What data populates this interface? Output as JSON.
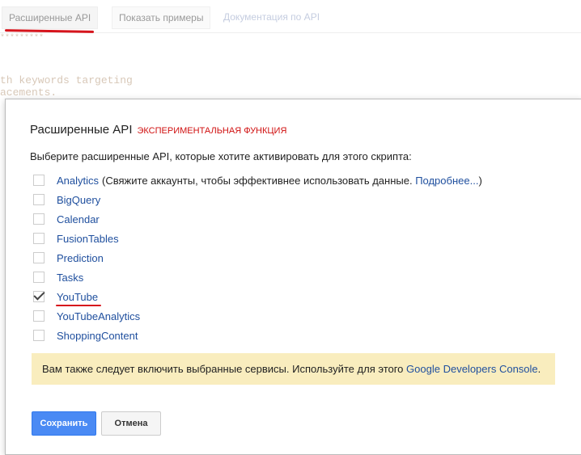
{
  "toolbar": {
    "advanced_api": "Расширенные API",
    "show_examples": "Показать примеры",
    "api_docs": "Документация по API"
  },
  "code_lines": [
    "*********",
    "th keywords targeting",
    "acements."
  ],
  "dialog": {
    "title": "Расширенные API",
    "experimental": "ЭКСПЕРИМЕНТАЛЬНАЯ ФУНКЦИЯ",
    "intro": "Выберите расширенные API, которые хотите активировать для этого скрипта:",
    "items": [
      {
        "label": "Analytics",
        "checked": false,
        "desc": "(Свяжите аккаунты, чтобы эффективнее использовать данные.",
        "more": "Подробнее...",
        "close": ")"
      },
      {
        "label": "BigQuery",
        "checked": false
      },
      {
        "label": "Calendar",
        "checked": false
      },
      {
        "label": "FusionTables",
        "checked": false
      },
      {
        "label": "Prediction",
        "checked": false
      },
      {
        "label": "Tasks",
        "checked": false
      },
      {
        "label": "YouTube",
        "checked": true
      },
      {
        "label": "YouTubeAnalytics",
        "checked": false
      },
      {
        "label": "ShoppingContent",
        "checked": false
      }
    ],
    "note": "Вам также следует включить выбранные сервисы. Используйте для этого",
    "note_link": "Google Developers Console",
    "note_end": ".",
    "save": "Сохранить",
    "cancel": "Отмена"
  }
}
